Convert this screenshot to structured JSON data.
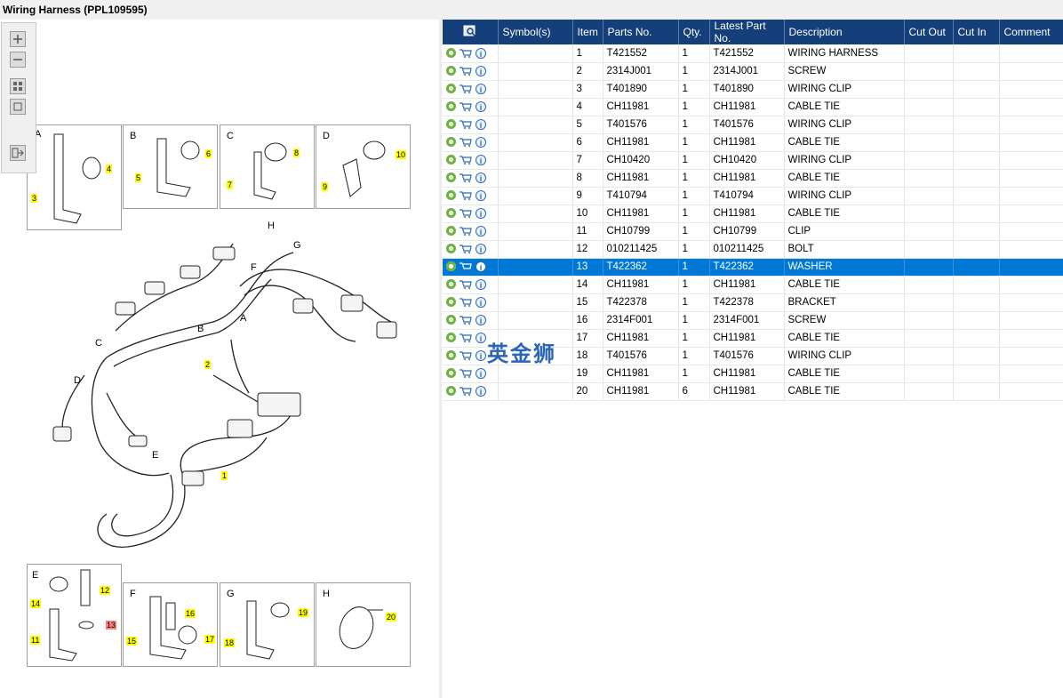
{
  "window": {
    "title": "Wiring Harness (PPL109595)"
  },
  "watermark": "英金狮",
  "colors": {
    "header_bg": "#143f7b",
    "selected_row": "#0078d7",
    "callout": "#ffff00",
    "callout_alert": "#ff8080"
  },
  "toolbar": {
    "icons": [
      "zoom-in-icon",
      "zoom-out-icon",
      "fit-grid-icon",
      "fit-page-icon",
      "export-icon"
    ]
  },
  "diagram": {
    "detail_top": [
      {
        "label": "A",
        "callouts": [
          "3",
          "4"
        ]
      },
      {
        "label": "B",
        "callouts": [
          "5",
          "6"
        ]
      },
      {
        "label": "C",
        "callouts": [
          "7",
          "8"
        ]
      },
      {
        "label": "D",
        "callouts": [
          "9",
          "10"
        ]
      }
    ],
    "main_labels": [
      "H",
      "G",
      "F",
      "A",
      "B",
      "C",
      "D",
      "E"
    ],
    "main_callouts": [
      "2",
      "1"
    ],
    "detail_bottom": [
      {
        "label": "E",
        "callouts": [
          "12",
          "14",
          "13",
          "11"
        ]
      },
      {
        "label": "F",
        "callouts": [
          "16",
          "15",
          "17"
        ]
      },
      {
        "label": "G",
        "callouts": [
          "19",
          "18"
        ]
      },
      {
        "label": "H",
        "callouts": [
          "20"
        ]
      }
    ]
  },
  "table": {
    "columns": [
      "",
      "Symbol(s)",
      "Item",
      "Parts No.",
      "Qty.",
      "Latest Part No.",
      "Description",
      "Cut Out",
      "Cut In",
      "Comment"
    ],
    "selected_index": 12,
    "rows": [
      {
        "item": "1",
        "parts_no": "T421552",
        "qty": "1",
        "latest": "T421552",
        "desc": "WIRING HARNESS"
      },
      {
        "item": "2",
        "parts_no": "2314J001",
        "qty": "1",
        "latest": "2314J001",
        "desc": "SCREW"
      },
      {
        "item": "3",
        "parts_no": "T401890",
        "qty": "1",
        "latest": "T401890",
        "desc": "WIRING CLIP"
      },
      {
        "item": "4",
        "parts_no": "CH11981",
        "qty": "1",
        "latest": "CH11981",
        "desc": "CABLE TIE"
      },
      {
        "item": "5",
        "parts_no": "T401576",
        "qty": "1",
        "latest": "T401576",
        "desc": "WIRING CLIP"
      },
      {
        "item": "6",
        "parts_no": "CH11981",
        "qty": "1",
        "latest": "CH11981",
        "desc": "CABLE TIE"
      },
      {
        "item": "7",
        "parts_no": "CH10420",
        "qty": "1",
        "latest": "CH10420",
        "desc": "WIRING CLIP"
      },
      {
        "item": "8",
        "parts_no": "CH11981",
        "qty": "1",
        "latest": "CH11981",
        "desc": "CABLE TIE"
      },
      {
        "item": "9",
        "parts_no": "T410794",
        "qty": "1",
        "latest": "T410794",
        "desc": "WIRING CLIP"
      },
      {
        "item": "10",
        "parts_no": "CH11981",
        "qty": "1",
        "latest": "CH11981",
        "desc": "CABLE TIE"
      },
      {
        "item": "11",
        "parts_no": "CH10799",
        "qty": "1",
        "latest": "CH10799",
        "desc": "CLIP"
      },
      {
        "item": "12",
        "parts_no": "010211425",
        "qty": "1",
        "latest": "010211425",
        "desc": "BOLT"
      },
      {
        "item": "13",
        "parts_no": "T422362",
        "qty": "1",
        "latest": "T422362",
        "desc": "WASHER"
      },
      {
        "item": "14",
        "parts_no": "CH11981",
        "qty": "1",
        "latest": "CH11981",
        "desc": "CABLE TIE"
      },
      {
        "item": "15",
        "parts_no": "T422378",
        "qty": "1",
        "latest": "T422378",
        "desc": "BRACKET"
      },
      {
        "item": "16",
        "parts_no": "2314F001",
        "qty": "1",
        "latest": "2314F001",
        "desc": "SCREW"
      },
      {
        "item": "17",
        "parts_no": "CH11981",
        "qty": "1",
        "latest": "CH11981",
        "desc": "CABLE TIE"
      },
      {
        "item": "18",
        "parts_no": "T401576",
        "qty": "1",
        "latest": "T401576",
        "desc": "WIRING CLIP"
      },
      {
        "item": "19",
        "parts_no": "CH11981",
        "qty": "1",
        "latest": "CH11981",
        "desc": "CABLE TIE"
      },
      {
        "item": "20",
        "parts_no": "CH11981",
        "qty": "6",
        "latest": "CH11981",
        "desc": "CABLE TIE"
      }
    ]
  }
}
